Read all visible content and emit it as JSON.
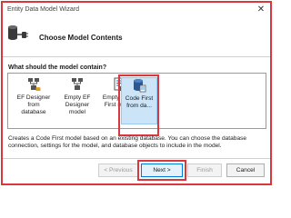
{
  "window": {
    "title": "Entity Data Model Wizard",
    "close_glyph": "✕"
  },
  "header": {
    "heading": "Choose Model Contents",
    "icon": "database-plug-icon"
  },
  "prompt": "What should the model contain?",
  "options": [
    {
      "line1": "EF Designer",
      "line2": "from",
      "line3": "database",
      "icon": "ef-designer-db-icon",
      "selected": false
    },
    {
      "line1": "Empty EF",
      "line2": "Designer",
      "line3": "model",
      "icon": "empty-ef-designer-icon",
      "selected": false
    },
    {
      "line1": "Empty Code",
      "line2": "First model",
      "line3": "",
      "icon": "empty-code-first-icon",
      "selected": false
    },
    {
      "line1": "Code First",
      "line2": "from da...",
      "line3": "",
      "icon": "code-first-db-icon",
      "selected": true
    }
  ],
  "description": "Creates a Code First model based on an existing database. You can choose the database connection, settings for the model, and database objects to include in the model.",
  "buttons": {
    "previous": "< Previous",
    "next": "Next >",
    "finish": "Finish",
    "cancel": "Cancel"
  },
  "colors": {
    "accent": "#0078d7",
    "selection": "#cce4f7",
    "highlight_box": "#d9363e"
  }
}
